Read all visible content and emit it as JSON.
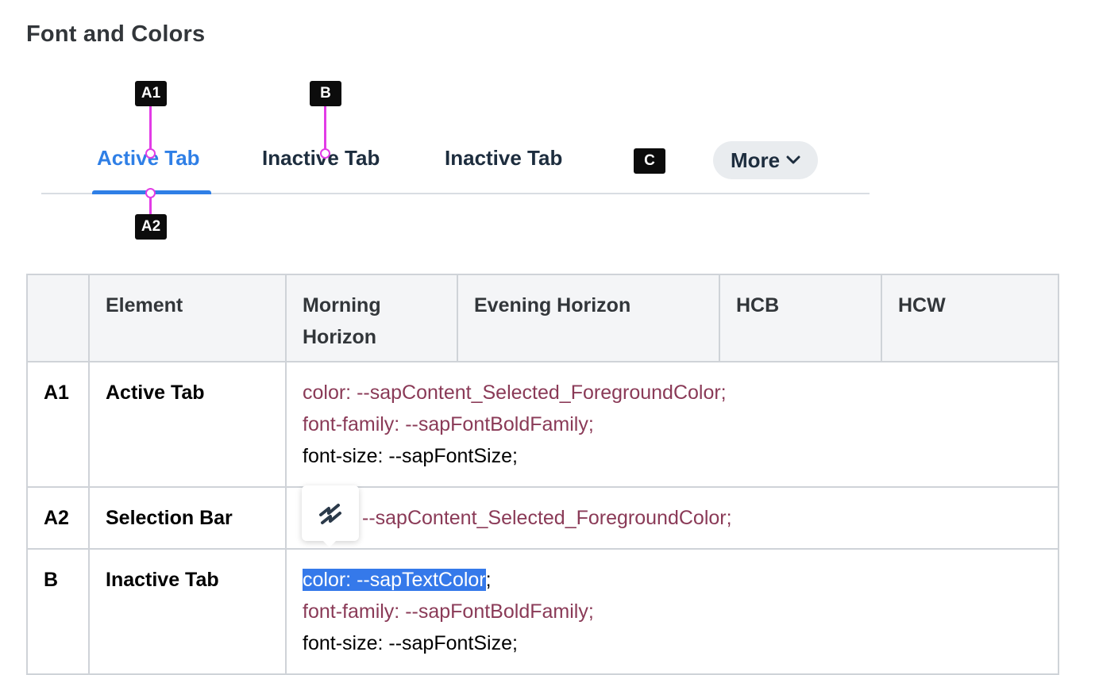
{
  "page": {
    "title": "Font and Colors"
  },
  "tabs": {
    "items": [
      {
        "label": "Active Tab",
        "state": "active"
      },
      {
        "label": "Inactive Tab",
        "state": "inactive"
      },
      {
        "label": "Inactive Tab",
        "state": "inactive"
      }
    ],
    "more_label": "More",
    "more_icon": "chevron-down-icon",
    "accent_color": "#2f7fe6"
  },
  "badges": {
    "a1": "A1",
    "a2": "A2",
    "b": "B",
    "c": "C"
  },
  "table": {
    "headers": [
      "",
      "Element",
      "Morning Horizon",
      "Evening Horizon",
      "HCB",
      "HCW"
    ],
    "rows": [
      {
        "id": "A1",
        "element": "Active Tab",
        "values": [
          "color: --sapContent_Selected_ForegroundColor;",
          "font-family: --sapFontBoldFamily;",
          "font-size: --sapFontSize;"
        ]
      },
      {
        "id": "A2",
        "element": "Selection Bar",
        "values": [
          "--sapContent_Selected_ForegroundColor;"
        ]
      },
      {
        "id": "B",
        "element": "Inactive Tab",
        "values": [
          "color: --sapTextColor",
          ";",
          "font-family: --sapFontBoldFamily;",
          "font-size: --sapFontSize;"
        ]
      }
    ]
  },
  "floating_toolbar": {
    "icon": "app-logo-icon"
  }
}
